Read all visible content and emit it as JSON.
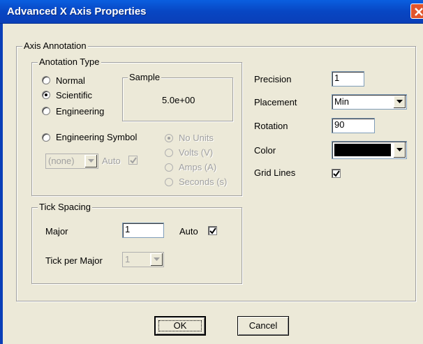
{
  "window": {
    "title": "Advanced X Axis Properties"
  },
  "axis_annotation": {
    "group_label": "Axis Annotation",
    "annotation_type": {
      "group_label": "Anotation Type",
      "options": [
        "Normal",
        "Scientific",
        "Engineering",
        "Engineering Symbol"
      ],
      "selected": "Scientific",
      "sample": {
        "label": "Sample",
        "value": "5.0e+00"
      },
      "symbol_dropdown": {
        "value": "(none)"
      },
      "auto_label": "Auto",
      "auto_checked": true,
      "unit_options": [
        "No Units",
        "Volts (V)",
        "Amps (A)",
        "Seconds (s)"
      ],
      "unit_selected": "No Units"
    },
    "precision": {
      "label": "Precision",
      "value": "1"
    },
    "placement": {
      "label": "Placement",
      "value": "Min"
    },
    "rotation": {
      "label": "Rotation",
      "value": "90"
    },
    "color": {
      "label": "Color",
      "value": "#000000"
    },
    "grid_lines": {
      "label": "Grid Lines",
      "checked": true
    },
    "tick_spacing": {
      "group_label": "Tick Spacing",
      "major": {
        "label": "Major",
        "value": "1"
      },
      "auto_label": "Auto",
      "auto_checked": true,
      "tick_per_major": {
        "label": "Tick per Major",
        "value": "1"
      }
    }
  },
  "buttons": {
    "ok": "OK",
    "cancel": "Cancel"
  }
}
